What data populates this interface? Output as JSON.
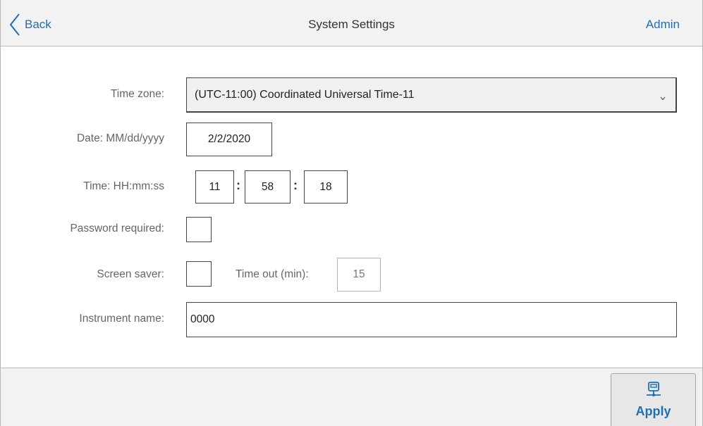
{
  "header": {
    "back_label": "Back",
    "title": "System Settings",
    "user": "Admin"
  },
  "form": {
    "time_zone": {
      "label": "Time zone:",
      "value": "(UTC-11:00) Coordinated Universal Time-11"
    },
    "date": {
      "label": "Date: MM/dd/yyyy",
      "value": "2/2/2020"
    },
    "time": {
      "label": "Time: HH:mm:ss",
      "hours": "11",
      "minutes": "58",
      "seconds": "18",
      "separator": ":"
    },
    "password_required": {
      "label": "Password required:",
      "checked": false
    },
    "screen_saver": {
      "label": "Screen saver:",
      "checked": false,
      "timeout_label": "Time out (min):",
      "timeout_value": "15"
    },
    "instrument_name": {
      "label": "Instrument name:",
      "value": "0000"
    }
  },
  "footer": {
    "apply_label": "Apply"
  },
  "icons": {
    "back": "chevron-left-icon",
    "dropdown": "chevron-down-icon",
    "apply": "network-apply-icon"
  },
  "colors": {
    "accent": "#1f6fb5",
    "header_bg": "#f2f2f2",
    "label_text": "#666666"
  }
}
